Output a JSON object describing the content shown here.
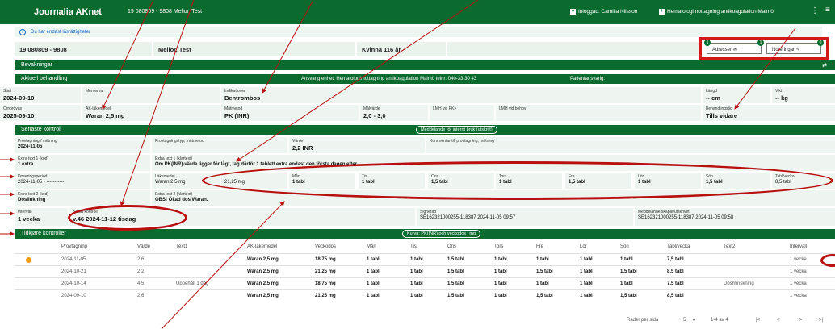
{
  "appbar": {
    "title": "Journalia AKnet",
    "patient": "19 080809 - 9808   Melior, Test",
    "user": "Inloggad: Camilla Nilsson",
    "unit": "Hematologimottagning antikoagulation Malmö",
    "more": "⋮",
    "menu": "≡"
  },
  "info": {
    "text": "Du har endast läsrättigheter"
  },
  "patient": {
    "pnr": "19 080809 - 9808",
    "name": "Melior, Test",
    "sex_age": "Kvinna 116 år"
  },
  "buttons": {
    "adresser": "Adresser",
    "adresser_count": "1",
    "noteringar": "Noteringar",
    "noteringar_count": "0",
    "badge_left": "1"
  },
  "bands": {
    "bevakningar": "Bevakningar",
    "aktuell": "Aktuell behandling",
    "ansvarig": "Ansvarig enhet: Hematologimottagning antikoagulation Malmö telnr: 040-33 30 43",
    "patientansvarig": "Patientansvarig:",
    "senaste": "Senaste kontroll",
    "meddelande_chip": "Meddelande för internt bruk (utskrift)",
    "tidigare": "Tidigare kontroller",
    "kurva_chip": "Kurva: PK(INR) och veckodos i mg"
  },
  "aktuell": {
    "start_label": "Start",
    "start": "2024-09-10",
    "mernema_label": "Mernema",
    "mernema": "",
    "indikation_label": "Indikationer",
    "indikation": "Bentrombos",
    "langd_label": "Längd",
    "langd": "-- cm",
    "vikt_label": "Vikt",
    "vikt": "-- kg",
    "omprov_label": "Omprövas",
    "omprov": "2025-09-10",
    "ak_label": "AK-läkemedel",
    "ak": "Waran 2,5 mg",
    "mattmetod_label": "Mätmetod",
    "mattmetod": "PK (INR)",
    "malvarde_label": "Målvärde",
    "malvarde": "2,0 - 3,0",
    "lmh_label": "LMH vid PK>",
    "lmh": "",
    "lmh2_label": "LMH vid behov",
    "lmh2": "",
    "behtid_label": "Behandlingstid",
    "behtid": "Tills vidare"
  },
  "senaste": {
    "prov_label": "Provtagning / mätning",
    "prov": "2024-11-05",
    "provtyp_label": "Provtagningstyp, mätmetod",
    "provtyp": "",
    "varde_label": "Värde",
    "varde": "2,2 INR",
    "kommentar_label": "Kommentar till provtagning, mätning",
    "kommentar": "",
    "extra1_label": "Extra text 1 (kod)",
    "extra1": "1 extra",
    "extra1b_label": "Extra text 1 (klartext)",
    "extra1b": "Om PK(INR)-värde ligger för lågt, tag därför 1 tablett extra endast den första dagen efter...",
    "dos_label": "Doseringsperiod",
    "dos": "2024-11-05 - -----------",
    "lakemedel_label": "Läkemedel",
    "lakemedel": "Waran 2,5 mg",
    "veckodos": "21,25 mg",
    "days": [
      {
        "label": "Mån",
        "value": "1 tabl"
      },
      {
        "label": "Tis",
        "value": "1 tabl"
      },
      {
        "label": "Ons",
        "value": "1,5 tabl"
      },
      {
        "label": "Tors",
        "value": "1 tabl"
      },
      {
        "label": "Fre",
        "value": "1,5 tabl"
      },
      {
        "label": "Lör",
        "value": "1 tabl"
      },
      {
        "label": "Sön",
        "value": "1,5 tabl"
      }
    ],
    "tablvecka_label": "Tabl/vecka",
    "tablvecka": "8,5 tabl",
    "extra2_label": "Extra text 2 (kod)",
    "extra2": "Doslinkning",
    "extra2b_label": "Extra text 2 (klartext)",
    "extra2b": "OBS! Ökad dos Waran.",
    "intervall_label": "Intervall",
    "intervall": "1 vecka",
    "nasta_label": "Nästa kontroll",
    "nasta": "v.46 2024-11-12 tisdag",
    "signerad_label": "Signerad",
    "signerad": "SE162321000255-118387 2024-11-05 09:57",
    "meddelande_label": "Meddelande skapat/utskrivet",
    "meddelande": "SE162321000255-118387 2024-11-05 09:58"
  },
  "tidigare": {
    "headers": [
      "Provtagning ↓",
      "Värde",
      "Text1",
      "AK-läkemedel",
      "Veckodos",
      "Mån",
      "Tis",
      "Ons",
      "Tors",
      "Fre",
      "Lör",
      "Sön",
      "Tabl/vecka",
      "Text2",
      "Intervall"
    ],
    "rows": [
      [
        "2024-11-05",
        "2,6",
        "",
        "Waran 2,5 mg",
        "18,75 mg",
        "1 tabl",
        "1 tabl",
        "1,5 tabl",
        "1 tabl",
        "1 tabl",
        "1 tabl",
        "1 tabl",
        "7,5 tabl",
        "",
        "1 vecka"
      ],
      [
        "2024-10-21",
        "2,2",
        "",
        "Waran 2,5 mg",
        "21,25 mg",
        "1 tabl",
        "1 tabl",
        "1,5 tabl",
        "1 tabl",
        "1,5 tabl",
        "1 tabl",
        "1,5 tabl",
        "8,5 tabl",
        "",
        "1 vecka"
      ],
      [
        "2024-10-14",
        "4,5",
        "Uppehåll 1 dag",
        "Waran 2,5 mg",
        "18,75 mg",
        "1 tabl",
        "1 tabl",
        "1,5 tabl",
        "1 tabl",
        "1 tabl",
        "1 tabl",
        "1 tabl",
        "7,5 tabl",
        "Dosminskning",
        "1 vecka"
      ],
      [
        "2024-09-10",
        "2,6",
        "",
        "Waran 2,5 mg",
        "21,25 mg",
        "1 tabl",
        "1 tabl",
        "1,5 tabl",
        "1 tabl",
        "1,5 tabl",
        "1 tabl",
        "1,5 tabl",
        "8,5 tabl",
        "",
        "1 vecka"
      ]
    ]
  },
  "footer": {
    "rows_per_page": "Rader per sida",
    "per_page": "5",
    "range": "1-4 av 4"
  },
  "colors": {
    "brand": "#0b6b2e",
    "annotation": "#b80f0f"
  }
}
